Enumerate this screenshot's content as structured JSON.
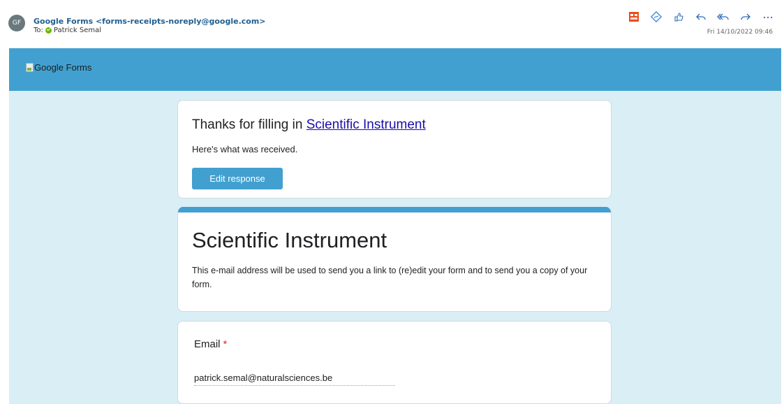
{
  "header": {
    "avatar_initials": "GF",
    "sender": "Google Forms <forms-receipts-noreply@google.com>",
    "to_prefix": "To:",
    "to_name": "Patrick Semal",
    "date": "Fri 14/10/2022 09:46",
    "toolbar_icons": [
      "office-addin-icon",
      "viva-insights-icon",
      "like-icon",
      "reply-icon",
      "reply-all-icon",
      "forward-icon",
      "more-icon"
    ]
  },
  "banner": {
    "logo_alt": "Google Forms",
    "color": "#42a0d0"
  },
  "receipt": {
    "thanks_prefix": "Thanks for filling in ",
    "form_link": "Scientific Instrument",
    "received_text": "Here's what was received.",
    "edit_button": "Edit response"
  },
  "form": {
    "title": "Scientific Instrument",
    "description": "This e-mail address will be used to send you a link to (re)edit your form and to send you a copy of your form."
  },
  "question": {
    "label": "Email",
    "required_marker": "*",
    "answer": "patrick.semal@naturalsciences.be"
  },
  "colors": {
    "accent": "#42a0d0",
    "background": "#daeef5",
    "link": "#1a0dab",
    "required": "#d93025"
  }
}
